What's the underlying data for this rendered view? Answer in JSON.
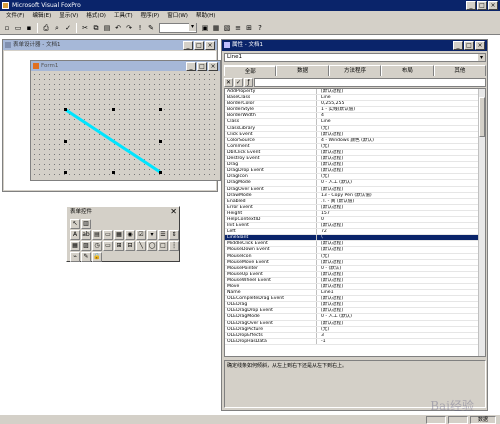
{
  "app": {
    "title": "Microsoft Visual FoxPro"
  },
  "menubar": [
    "文件(F)",
    "编辑(E)",
    "显示(V)",
    "格式(O)",
    "工具(T)",
    "程序(P)",
    "窗口(W)",
    "帮助(H)"
  ],
  "form_designer": {
    "title": "表单设计器 - 文档1"
  },
  "form1": {
    "title": "Form1"
  },
  "controls_toolbar": {
    "title": "表单控件"
  },
  "properties": {
    "title": "属性 - 文档1",
    "object": "Line1",
    "tabs": [
      "全部",
      "数据",
      "方法程序",
      "布局",
      "其他"
    ],
    "rows": [
      {
        "name": "AddProperty",
        "value": "[默认过程]"
      },
      {
        "name": "BaseClass",
        "value": "Line"
      },
      {
        "name": "BorderColor",
        "value": "0,255,255"
      },
      {
        "name": "BorderStyle",
        "value": "1 - 实线(默认值)"
      },
      {
        "name": "BorderWidth",
        "value": "4"
      },
      {
        "name": "Class",
        "value": "Line"
      },
      {
        "name": "ClassLibrary",
        "value": "(无)"
      },
      {
        "name": "Click Event",
        "value": "[默认过程]"
      },
      {
        "name": "ColorSource",
        "value": "4 - Windows 颜色 (默认)"
      },
      {
        "name": "Comment",
        "value": "(无)"
      },
      {
        "name": "DblClick Event",
        "value": "[默认过程]"
      },
      {
        "name": "Destroy Event",
        "value": "[默认过程]"
      },
      {
        "name": "Drag",
        "value": "[默认过程]"
      },
      {
        "name": "DragDrop Event",
        "value": "[默认过程]"
      },
      {
        "name": "DragIcon",
        "value": "(无)"
      },
      {
        "name": "DragMode",
        "value": "0 - 人工 (默认)"
      },
      {
        "name": "DragOver Event",
        "value": "[默认过程]"
      },
      {
        "name": "DrawMode",
        "value": "13 - Copy Pen (默认值)"
      },
      {
        "name": "Enabled",
        "value": ".T. - 真 (默认值)"
      },
      {
        "name": "Error Event",
        "value": "[默认过程]"
      },
      {
        "name": "Height",
        "value": "157"
      },
      {
        "name": "HelpContextID",
        "value": "0"
      },
      {
        "name": "Init Event",
        "value": "[默认过程]"
      },
      {
        "name": "Left",
        "value": "72"
      },
      {
        "name": "LineSlant",
        "value": "\\"
      },
      {
        "name": "MiddleClick Event",
        "value": "[默认过程]"
      },
      {
        "name": "MouseDown Event",
        "value": "[默认过程]"
      },
      {
        "name": "MouseIcon",
        "value": "(无)"
      },
      {
        "name": "MouseMove Event",
        "value": "[默认过程]"
      },
      {
        "name": "MousePointer",
        "value": "0 - (默认)"
      },
      {
        "name": "MouseUp Event",
        "value": "[默认过程]"
      },
      {
        "name": "MouseWheel Event",
        "value": "[默认过程]"
      },
      {
        "name": "Move",
        "value": "[默认过程]"
      },
      {
        "name": "Name",
        "value": "Line1"
      },
      {
        "name": "OLECompleteDrag Event",
        "value": "[默认过程]"
      },
      {
        "name": "OLEDrag",
        "value": "[默认过程]"
      },
      {
        "name": "OLEDragDrop Event",
        "value": "[默认过程]"
      },
      {
        "name": "OLEDragMode",
        "value": "0 - 人工 (默认)"
      },
      {
        "name": "OLEDragOver Event",
        "value": "[默认过程]"
      },
      {
        "name": "OLEDragPicture",
        "value": "(无)"
      },
      {
        "name": "OLEDropEffects",
        "value": "3"
      },
      {
        "name": "OLEDropHasData",
        "value": "-1"
      }
    ],
    "selected_index": 24,
    "description": "确定线条如何倾斜，从左上到右下还是从左下到右上。"
  },
  "status": {
    "right": "数据"
  },
  "colors": {
    "title_active": "#0a246a",
    "line": "#00e5ff"
  },
  "watermark": "Bai经验"
}
